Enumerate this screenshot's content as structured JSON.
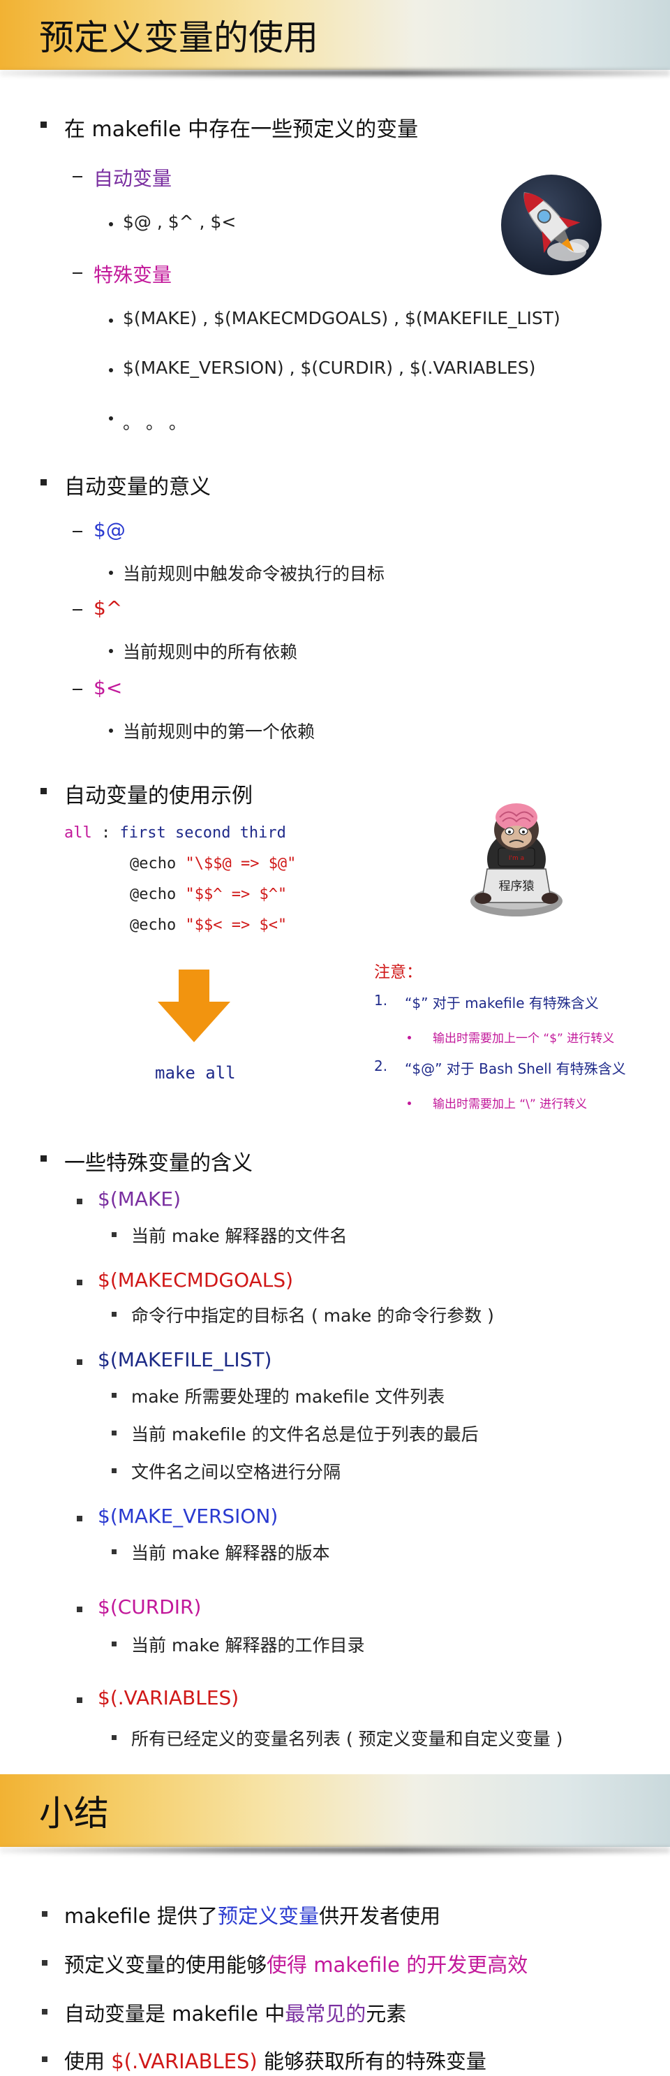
{
  "section1": {
    "title": "预定义变量的使用",
    "b1": "在 makefile 中存在一些预定义的变量",
    "auto_label": "自动变量",
    "auto_items": "$@ ,  $^ ,  $<",
    "special_label": "特殊变量",
    "special_line1": "$(MAKE) , $(MAKECMDGOALS) , $(MAKEFILE_LIST)",
    "special_line2": "$(MAKE_VERSION) , $(CURDIR) , $(.VARIABLES)",
    "special_line3": "。 。 。",
    "b2": "自动变量的意义",
    "var1": "$@",
    "var1_desc": "当前规则中触发命令被执行的目标",
    "var2": "$^",
    "var2_desc": "当前规则中的所有依赖",
    "var3": "$<",
    "var3_desc": "当前规则中的第一个依赖",
    "b3": "自动变量的使用示例",
    "code": {
      "l1_kw": "all",
      "l1_colon": " : ",
      "l1_deps": "first second third",
      "l2_cmd": "@echo ",
      "l2_str": "\"\\$$@ => $@\"",
      "l3_cmd": "@echo ",
      "l3_str": "\"$$^ => $^\"",
      "l4_cmd": "@echo ",
      "l4_str": "\"$$< => $<\""
    },
    "make_all": "make all",
    "note": {
      "title": "注意：",
      "n1_num": "1.",
      "n1": "“$” 对于 makefile 有特殊含义",
      "n1_sub": "输出时需要加上一个 “$” 进行转义",
      "n2_num": "2.",
      "n2": "“$@” 对于 Bash Shell 有特殊含义",
      "n2_sub": "输出时需要加上 “\\” 进行转义"
    },
    "monkey_sign": "程序猿",
    "b4": "一些特殊变量的含义",
    "sv": [
      {
        "name": "$(MAKE)",
        "descs": [
          "当前 make 解释器的文件名"
        ]
      },
      {
        "name": "$(MAKECMDGOALS)",
        "descs": [
          "命令行中指定的目标名 ( make 的命令行参数 )"
        ]
      },
      {
        "name": "$(MAKEFILE_LIST)",
        "descs": [
          "make 所需要处理的 makefile 文件列表",
          "当前 makefile 的文件名总是位于列表的最后",
          "文件名之间以空格进行分隔"
        ]
      },
      {
        "name": "$(MAKE_VERSION)",
        "descs": [
          "当前 make 解释器的版本"
        ]
      },
      {
        "name": "$(CURDIR)",
        "descs": [
          "当前 make 解释器的工作目录"
        ]
      },
      {
        "name": "$(.VARIABLES)",
        "descs": [
          "所有已经定义的变量名列表 ( 预定义变量和自定义变量 )"
        ]
      }
    ]
  },
  "section2": {
    "title": "小结",
    "s1_a": "makefile 提供了",
    "s1_b": "预定义变量",
    "s1_c": "供开发者使用",
    "s2_a": "预定义变量的使用能够",
    "s2_b": "使得 makefile 的开发更高效",
    "s3_a": "自动变量是 makefile 中",
    "s3_b": "最常见的",
    "s3_c": "元素",
    "s4_a": "使用 ",
    "s4_b": "$(.VARIABLES)",
    "s4_c": " 能够获取所有的特殊变量"
  },
  "colors": {
    "title_gold": "#f2b233",
    "purple": "#7a2fa0",
    "magenta": "#c2189a",
    "red": "#d01818",
    "blue": "#2a3ad0",
    "navy": "#1f2a8a",
    "arrow_orange": "#f2940f"
  },
  "icons": [
    "rocket-icon",
    "monkey-programmer-icon",
    "down-arrow-icon"
  ]
}
